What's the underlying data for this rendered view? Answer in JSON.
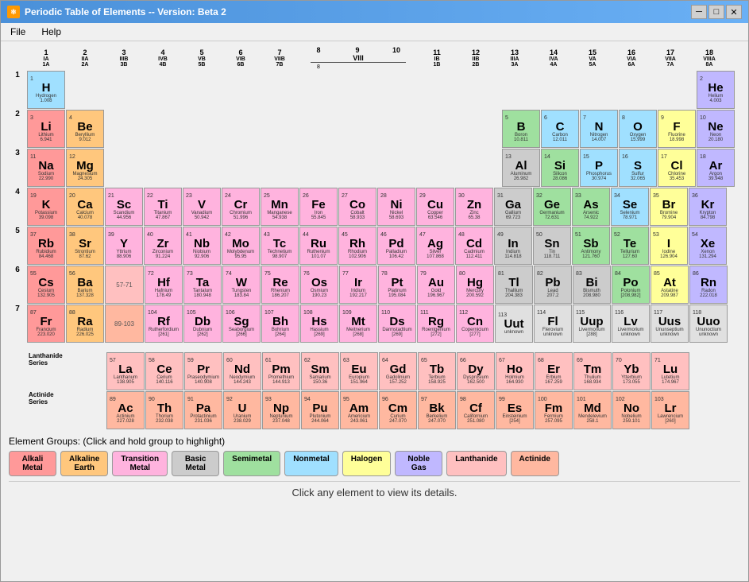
{
  "window": {
    "title": "Periodic Table of Elements  -- Version: Beta 2",
    "menu": [
      "File",
      "Help"
    ]
  },
  "groups_label": "Element Groups:  (Click and hold group to highlight)",
  "status": "Click any element to view its details.",
  "groups": [
    {
      "label": "Alkali\nMetal",
      "color": "#ff9999",
      "id": "alkali"
    },
    {
      "label": "Alkaline\nEarth",
      "color": "#ffc77d",
      "id": "alkaline"
    },
    {
      "label": "Transition\nMetal",
      "color": "#ffb3de",
      "id": "transition"
    },
    {
      "label": "Basic\nMetal",
      "color": "#cccccc",
      "id": "basic"
    },
    {
      "label": "Semimetal",
      "color": "#9fe09f",
      "id": "semimetal"
    },
    {
      "label": "Nonmetal",
      "color": "#a0e0ff",
      "id": "nonmetal"
    },
    {
      "label": "Halogen",
      "color": "#ffff99",
      "id": "halogen"
    },
    {
      "label": "Noble\nGas",
      "color": "#c0b8ff",
      "id": "noble"
    },
    {
      "label": "Lanthanide",
      "color": "#ffc0c0",
      "id": "lanthanide"
    },
    {
      "label": "Actinide",
      "color": "#ffb8a0",
      "id": "actinide"
    }
  ],
  "col_headers": [
    {
      "num": "1",
      "sub1": "IA",
      "sub2": "1A"
    },
    {
      "num": "2",
      "sub1": "IIA",
      "sub2": "2A"
    },
    {
      "num": "3",
      "sub1": "IIIB",
      "sub2": "3B"
    },
    {
      "num": "4",
      "sub1": "IVB",
      "sub2": "4B"
    },
    {
      "num": "5",
      "sub1": "VB",
      "sub2": "5B"
    },
    {
      "num": "6",
      "sub1": "VIB",
      "sub2": "6B"
    },
    {
      "num": "7",
      "sub1": "VIIB",
      "sub2": "7B"
    },
    {
      "num": "8",
      "sub1": "VIII",
      "sub2": "8"
    },
    {
      "num": "9",
      "sub1": "",
      "sub2": ""
    },
    {
      "num": "10",
      "sub1": "",
      "sub2": ""
    },
    {
      "num": "11",
      "sub1": "IB",
      "sub2": "1B"
    },
    {
      "num": "12",
      "sub1": "IIB",
      "sub2": "2B"
    },
    {
      "num": "13",
      "sub1": "IIIA",
      "sub2": "3A"
    },
    {
      "num": "14",
      "sub1": "IVA",
      "sub2": "4A"
    },
    {
      "num": "15",
      "sub1": "VA",
      "sub2": "5A"
    },
    {
      "num": "16",
      "sub1": "VIA",
      "sub2": "6A"
    },
    {
      "num": "17",
      "sub1": "VIIA",
      "sub2": "7A"
    },
    {
      "num": "18",
      "sub1": "VIIIA",
      "sub2": "8A"
    }
  ]
}
